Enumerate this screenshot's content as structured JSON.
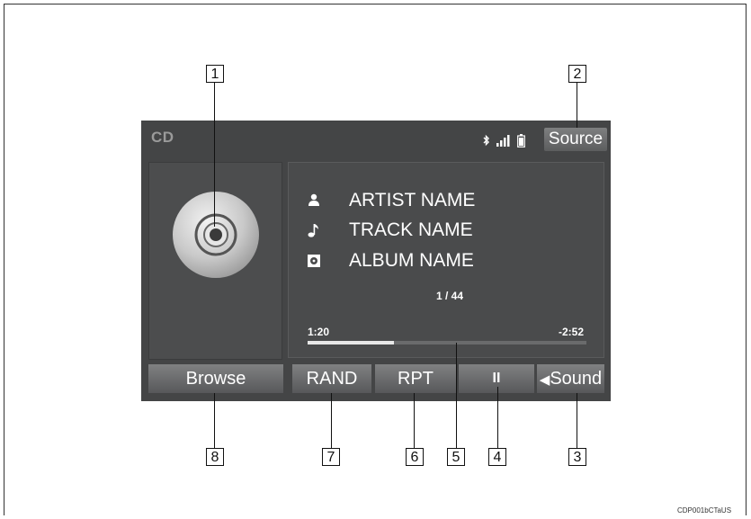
{
  "screen": {
    "source_label": "CD",
    "source_button": "Source",
    "status_icons": [
      "bluetooth-icon",
      "signal-bars-icon",
      "battery-icon"
    ],
    "artwork_icon": "cd-disc-icon",
    "metadata": [
      {
        "icon": "person-icon",
        "text": "ARTIST NAME"
      },
      {
        "icon": "music-note-icon",
        "text": "TRACK NAME"
      },
      {
        "icon": "album-icon",
        "text": "ALBUM NAME"
      }
    ],
    "track_count": "1 / 44",
    "elapsed": "1:20",
    "remaining": "-2:52",
    "progress_fraction": 0.31,
    "buttons": {
      "browse": "Browse",
      "rand": "RAND",
      "rpt": "RPT",
      "pause": "II",
      "sound": "Sound"
    }
  },
  "callouts": [
    "1",
    "2",
    "3",
    "4",
    "5",
    "6",
    "7",
    "8"
  ],
  "figure_code": "CDP001bCTaUS",
  "colors": {
    "screen_bg": "#444546",
    "button_top": "#808182",
    "button_bottom": "#57585a",
    "text": "#ffffff"
  }
}
